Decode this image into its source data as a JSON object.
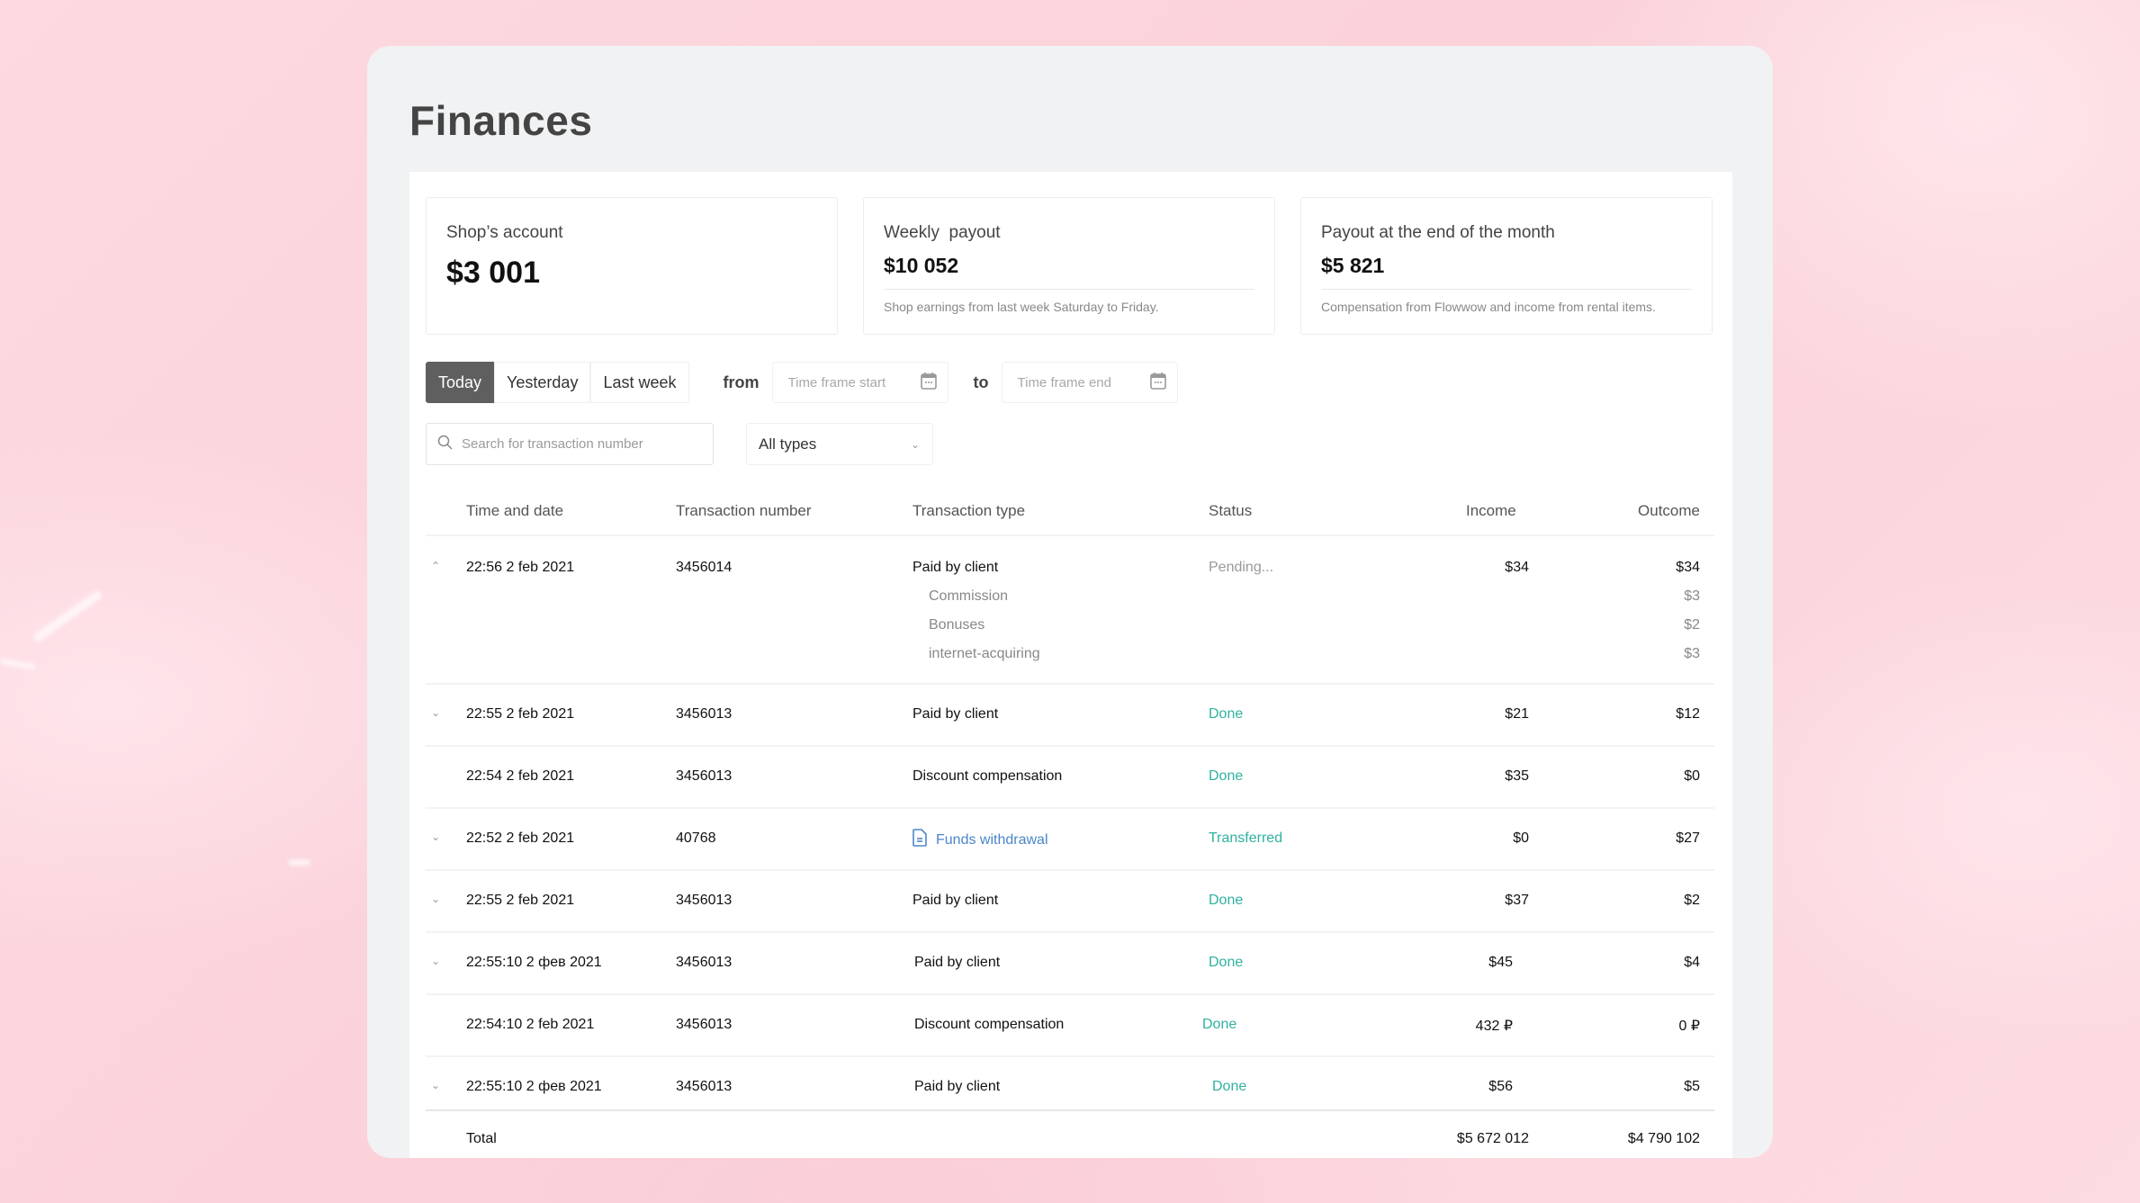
{
  "page": {
    "title": "Finances"
  },
  "cards": [
    {
      "label": "Shop’s account",
      "value": "$3 001"
    },
    {
      "label": "Weekly  payout",
      "value": "$10 052",
      "note": "Shop earnings from last week Saturday to Friday."
    },
    {
      "label": "Payout at the end of the month",
      "value": "$5 821",
      "note": "Compensation from Flowwow and income from rental items."
    }
  ],
  "filters": {
    "periods": [
      {
        "label": "Today",
        "active": true
      },
      {
        "label": "Yesterday",
        "active": false
      },
      {
        "label": "Last week",
        "active": false
      }
    ],
    "from_label": "from",
    "to_label": "to",
    "start_placeholder": "Time frame start",
    "end_placeholder": "Time frame end",
    "search_placeholder": "Search for transaction number",
    "search_value": "",
    "type_select": "All types"
  },
  "table": {
    "columns": [
      "Time and date",
      "Transaction number",
      "Transaction type",
      "Status",
      "Income",
      "Outcome"
    ],
    "rows": [
      {
        "expander": "up",
        "date": "22:56 2 feb 2021",
        "number": "3456014",
        "type": "Paid by client",
        "status": "Pending...",
        "status_kind": "pending",
        "income": "$34",
        "outcome": "$34",
        "details": [
          {
            "label": "Commission",
            "outcome": "$3"
          },
          {
            "label": "Bonuses",
            "outcome": "$2"
          },
          {
            "label": "internet-acquiring",
            "outcome": "$3"
          }
        ]
      },
      {
        "expander": "down",
        "date": "22:55 2 feb 2021",
        "number": "3456013",
        "type": "Paid by client",
        "status": "Done",
        "status_kind": "done",
        "income": "$21",
        "outcome": "$12"
      },
      {
        "expander": "",
        "date": "22:54 2 feb 2021",
        "number": "3456013",
        "type": "Discount compensation",
        "status": "Done",
        "status_kind": "done",
        "income": "$35",
        "outcome": "$0"
      },
      {
        "expander": "down",
        "date": "22:52 2 feb 2021",
        "number": "40768",
        "type": "Funds withdrawal",
        "type_icon": "document-icon",
        "status": "Transferred",
        "status_kind": "done",
        "income": "$0",
        "outcome": "$27"
      },
      {
        "expander": "down",
        "date": "22:55 2 feb 2021",
        "number": "3456013",
        "type": "Paid by client",
        "status": "Done",
        "status_kind": "done",
        "income": "$37",
        "outcome": "$2"
      },
      {
        "expander": "down",
        "date": "22:55:10  2 фев 2021",
        "number": "3456013",
        "type": "Paid by client",
        "status": "Done",
        "status_kind": "done",
        "income": "$45",
        "outcome": "$4"
      },
      {
        "expander": "",
        "date": "22:54:10  2 feb 2021",
        "number": "3456013",
        "type": "Discount compensation",
        "status": "Done",
        "status_kind": "done",
        "income": "432 ₽",
        "outcome": "0 ₽"
      },
      {
        "expander": "down",
        "date": "22:55:10  2 фев 2021",
        "number": "3456013",
        "type": "Paid by client",
        "status": "Done",
        "status_kind": "done",
        "income": "$56",
        "outcome": "$5"
      }
    ],
    "total": {
      "label": "Total",
      "income": "$5 672 012",
      "outcome": "$4 790 102"
    }
  },
  "colors": {
    "status_done": "#2fb1a0",
    "link": "#4a86c8",
    "active_tab": "#5f5f5f",
    "panel_bg": "#f1f2f4",
    "page_bg": "#fcd6dd"
  },
  "icons": {
    "calendar": "calendar-icon",
    "search": "search-icon",
    "chevron_down": "chevron-down-icon",
    "chevron_up": "chevron-up-icon",
    "document": "document-icon"
  }
}
